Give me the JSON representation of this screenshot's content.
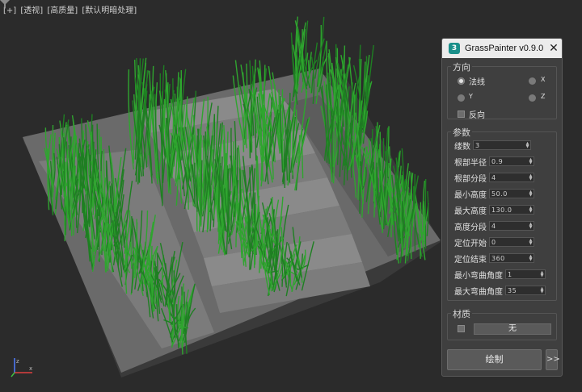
{
  "viewport": {
    "menu": [
      "[+]",
      "[透视]",
      "[高质量]",
      "[默认明暗处理]"
    ],
    "filter_icon": "funnel-icon",
    "axis_icon": "xyz-gizmo-icon"
  },
  "panel": {
    "title": "GrassPainter v0.9.0",
    "app_icon_glyph": "3",
    "close_glyph": "✕",
    "direction": {
      "label": "方向",
      "options": [
        "法线",
        "X",
        "Y",
        "Z"
      ],
      "selected": "法线",
      "reverse_label": "反向"
    },
    "params": {
      "label": "参数",
      "rows": [
        {
          "label": "缕数",
          "value": "3"
        },
        {
          "label": "根部半径",
          "value": "0.9"
        },
        {
          "label": "根部分段",
          "value": "4"
        },
        {
          "label": "最小高度",
          "value": "50.0"
        },
        {
          "label": "最大高度",
          "value": "130.0"
        },
        {
          "label": "高度分段",
          "value": "4"
        },
        {
          "label": "定位开始",
          "value": "0"
        },
        {
          "label": "定位结束",
          "value": "360"
        },
        {
          "label": "最小弯曲角度",
          "value": "1"
        },
        {
          "label": "最大弯曲角度",
          "value": "35"
        }
      ]
    },
    "material": {
      "label": "材质",
      "button": "无"
    },
    "draw_button": "绘制",
    "more_button": ">>"
  },
  "colors": {
    "background": "#2b2b2b",
    "ground": "#6e6e6e",
    "grass": "#2fa52f",
    "panel": "#3f3f3f"
  }
}
